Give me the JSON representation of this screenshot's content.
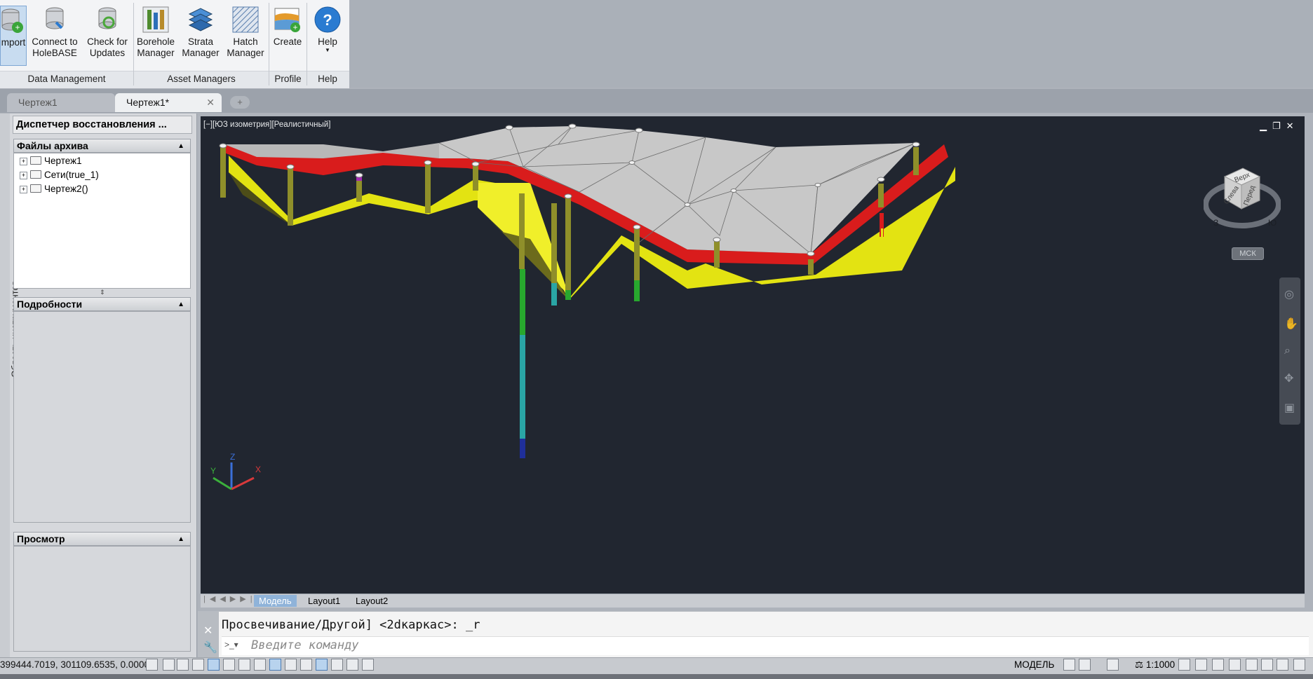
{
  "ribbon": {
    "buttons": [
      {
        "label": "mport"
      },
      {
        "label": "Connect to\nHoleBASE"
      },
      {
        "label": "Check for\nUpdates"
      },
      {
        "label": "Borehole\nManager"
      },
      {
        "label": "Strata\nManager"
      },
      {
        "label": "Hatch\nManager"
      },
      {
        "label": "Create"
      },
      {
        "label": "Help"
      }
    ],
    "groups": [
      "Data Management",
      "Asset Managers",
      "Profile",
      "Help"
    ]
  },
  "tabs": [
    {
      "label": "Чертеж1"
    },
    {
      "label": "Чертеж1*"
    }
  ],
  "palette": {
    "title": "Диспетчер восстановления ...",
    "side_label": "Область инструментов",
    "archive_header": "Файлы архива",
    "archive_items": [
      "Чертеж1",
      "Сети(true_1)",
      "Чертеж2()"
    ],
    "details_header": "Подробности",
    "preview_header": "Просмотр"
  },
  "viewport": {
    "label": "[−][ЮЗ изометрия][Реалистичный]",
    "viewcube": {
      "top": "Верх",
      "left": "Слева",
      "front": "Перед",
      "compass_w": "З",
      "compass_s": "Ю"
    },
    "ucs_menu": "МСК",
    "ucs_axes": {
      "x": "X",
      "y": "Y",
      "z": "Z"
    }
  },
  "layouts": [
    "Модель",
    "Layout1",
    "Layout2"
  ],
  "command": {
    "history": "Просвечивание/Другой] <2dкаркас>: _r",
    "placeholder": "Введите команду"
  },
  "status": {
    "coords": "399444.7019, 301109.6535, 0.0000",
    "model": "МОДЕЛЬ",
    "scale": "1:1000"
  },
  "colors": {
    "red_layer": "#d91c1c",
    "yellow_layer": "#e8e812",
    "surface": "#c8c8c8",
    "viewport_bg": "#212630"
  }
}
